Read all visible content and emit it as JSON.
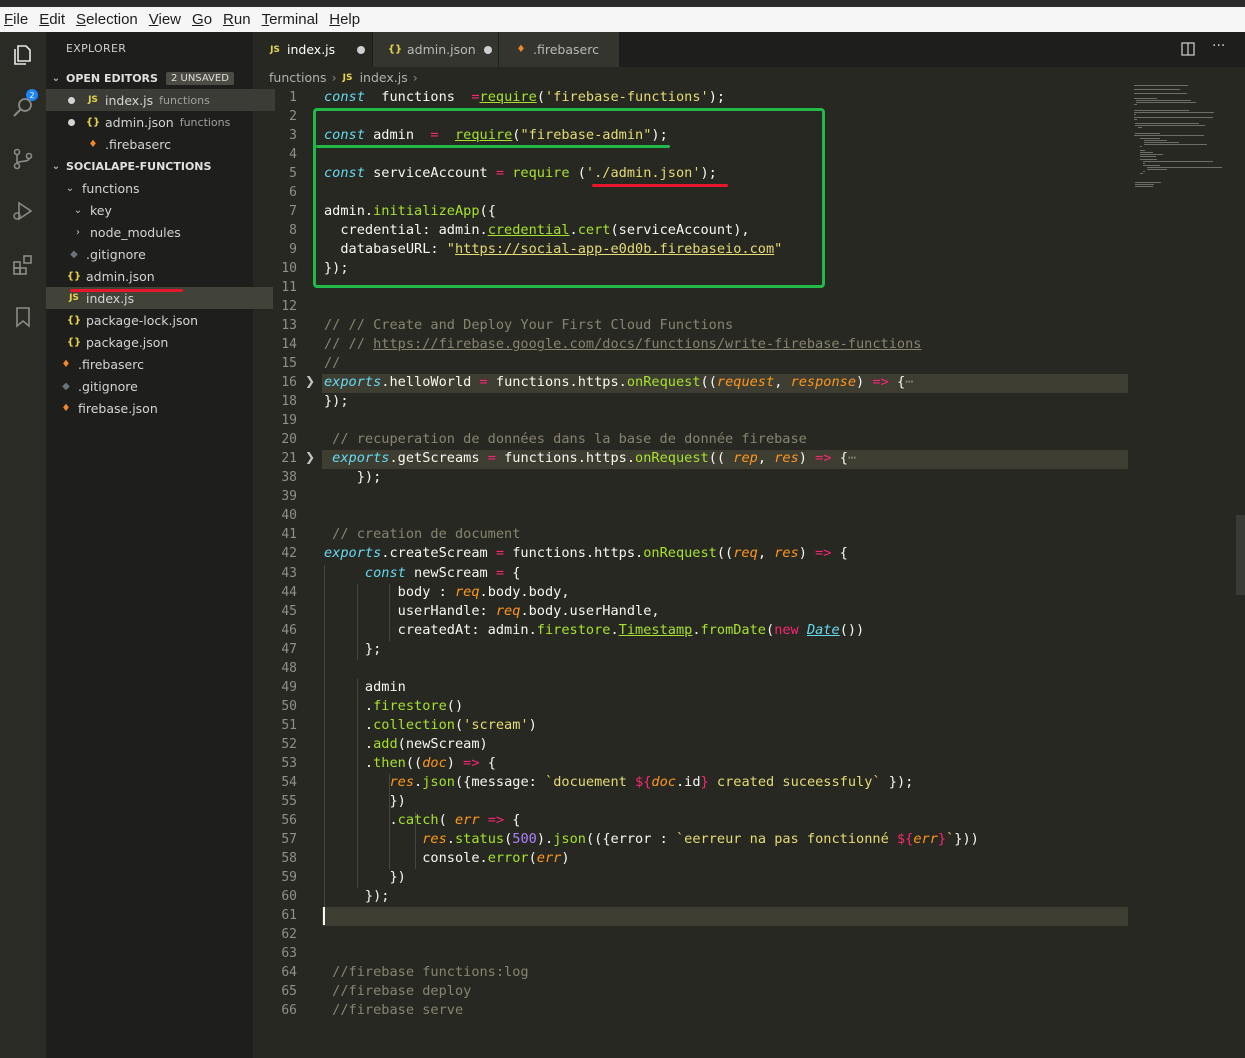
{
  "menu": [
    {
      "u": "F",
      "rest": "ile"
    },
    {
      "u": "E",
      "rest": "dit"
    },
    {
      "u": "S",
      "rest": "election"
    },
    {
      "u": "V",
      "rest": "iew"
    },
    {
      "u": "G",
      "rest": "o"
    },
    {
      "u": "R",
      "rest": "un"
    },
    {
      "u": "T",
      "rest": "erminal"
    },
    {
      "u": "H",
      "rest": "elp"
    }
  ],
  "activity": {
    "badge": "2"
  },
  "sidebar": {
    "title": "EXPLORER",
    "open_editors": {
      "label": "OPEN EDITORS",
      "unsaved": "2 UNSAVED",
      "items": [
        {
          "name": "index.js",
          "desc": "functions"
        },
        {
          "name": "admin.json",
          "desc": "functions"
        },
        {
          "name": ".firebaserc",
          "desc": ""
        }
      ]
    },
    "project": {
      "label": "SOCIALAPE-FUNCTIONS",
      "items": [
        {
          "name": "functions"
        },
        {
          "name": "key"
        },
        {
          "name": "node_modules"
        },
        {
          "name": ".gitignore"
        },
        {
          "name": "admin.json"
        },
        {
          "name": "index.js"
        },
        {
          "name": "package-lock.json"
        },
        {
          "name": "package.json"
        },
        {
          "name": ".firebaserc"
        },
        {
          "name": ".gitignore"
        },
        {
          "name": "firebase.json"
        }
      ]
    }
  },
  "tabs": [
    {
      "label": "index.js"
    },
    {
      "label": "admin.json"
    },
    {
      "label": ".firebaserc"
    }
  ],
  "breadcrumb": {
    "folder": "functions",
    "file": "index.js"
  },
  "editor": {
    "line_numbers": [
      "1",
      "2",
      "3",
      "4",
      "5",
      "6",
      "7",
      "8",
      "9",
      "10",
      "11",
      "12",
      "13",
      "14",
      "15",
      "16",
      "18",
      "19",
      "20",
      "21",
      "38",
      "39",
      "40",
      "41",
      "42",
      "43",
      "44",
      "45",
      "46",
      "47",
      "48",
      "49",
      "50",
      "51",
      "52",
      "53",
      "54",
      "55",
      "56",
      "57",
      "58",
      "59",
      "60",
      "61",
      "62",
      "63",
      "64",
      "65",
      "66"
    ],
    "lines": [
      [
        [
          "kw",
          "const"
        ],
        [
          "",
          "  functions  "
        ],
        [
          "op",
          "="
        ],
        [
          "",
          ""
        ],
        [
          "fn ul",
          "require"
        ],
        [
          "",
          "("
        ],
        [
          "str",
          "'firebase-functions'"
        ],
        [
          "",
          ");"
        ]
      ],
      [],
      [
        [
          "kw",
          "const"
        ],
        [
          "",
          " admin  "
        ],
        [
          "op",
          "="
        ],
        [
          "",
          "  "
        ],
        [
          "fn ul",
          "require"
        ],
        [
          "",
          "("
        ],
        [
          "str",
          "\"firebase-admin\""
        ],
        [
          "",
          ");"
        ]
      ],
      [],
      [
        [
          "kw",
          "const"
        ],
        [
          "",
          " serviceAccount "
        ],
        [
          "op",
          "="
        ],
        [
          "",
          " "
        ],
        [
          "fn",
          "require"
        ],
        [
          "",
          " ("
        ],
        [
          "str",
          "'./admin.json'"
        ],
        [
          "",
          ");"
        ]
      ],
      [],
      [
        [
          "",
          "admin."
        ],
        [
          "fn",
          "initializeApp"
        ],
        [
          "",
          "({"
        ]
      ],
      [
        [
          "",
          "  credential: admin."
        ],
        [
          "fn ul",
          "credential"
        ],
        [
          "",
          "."
        ],
        [
          "fn",
          "cert"
        ],
        [
          "",
          "(serviceAccount),"
        ]
      ],
      [
        [
          "",
          "  databaseURL: "
        ],
        [
          "str",
          "\""
        ],
        [
          "str ul",
          "https://social-app-e0d0b.firebaseio.com"
        ],
        [
          "str",
          "\""
        ]
      ],
      [
        [
          "",
          "});"
        ]
      ],
      [],
      [],
      [
        [
          "cm",
          "// // Create and Deploy Your First Cloud Functions"
        ]
      ],
      [
        [
          "cm",
          "// // "
        ],
        [
          "cm ul",
          "https://firebase.google.com/docs/functions/write-firebase-functions"
        ]
      ],
      [
        [
          "cm",
          "//"
        ]
      ],
      [
        [
          "ex",
          "exports"
        ],
        [
          "",
          ".helloWorld "
        ],
        [
          "op",
          "="
        ],
        [
          "",
          " functions.https."
        ],
        [
          "fn",
          "onRequest"
        ],
        [
          "",
          "(("
        ],
        [
          "par",
          "request"
        ],
        [
          "",
          ", "
        ],
        [
          "par",
          "response"
        ],
        [
          "",
          ") "
        ],
        [
          "op",
          "=>"
        ],
        [
          "",
          " {"
        ],
        [
          "cm",
          "⋯"
        ]
      ],
      [
        [
          "",
          ""
        ],
        [
          "",
          ""
        ],
        [
          "",
          "});"
        ]
      ],
      [],
      [
        [
          "cm",
          " // recuperation de données dans la base de donnée firebase"
        ]
      ],
      [
        [
          "ex",
          " exports"
        ],
        [
          "",
          ".getScreams "
        ],
        [
          "op",
          "="
        ],
        [
          "",
          " functions.https."
        ],
        [
          "fn",
          "onRequest"
        ],
        [
          "",
          "(( "
        ],
        [
          "par",
          "rep"
        ],
        [
          "",
          ", "
        ],
        [
          "par",
          "res"
        ],
        [
          "",
          ") "
        ],
        [
          "op",
          "=>"
        ],
        [
          "",
          " {"
        ],
        [
          "cm",
          "⋯"
        ]
      ],
      [
        [
          "",
          "    });"
        ]
      ],
      [],
      [],
      [
        [
          "cm",
          " // creation de document"
        ]
      ],
      [
        [
          "ex",
          "exports"
        ],
        [
          "",
          ".createScream "
        ],
        [
          "op",
          "="
        ],
        [
          "",
          " functions.https."
        ],
        [
          "fn",
          "onRequest"
        ],
        [
          "",
          "(("
        ],
        [
          "par",
          "req"
        ],
        [
          "",
          ", "
        ],
        [
          "par",
          "res"
        ],
        [
          "",
          ") "
        ],
        [
          "op",
          "=>"
        ],
        [
          "",
          " {"
        ]
      ],
      [
        [
          "",
          "     "
        ],
        [
          "kw",
          "const"
        ],
        [
          "",
          " newScream "
        ],
        [
          "op",
          "="
        ],
        [
          "",
          " {"
        ]
      ],
      [
        [
          "",
          "         body : "
        ],
        [
          "par",
          "req"
        ],
        [
          "",
          ".body.body,"
        ]
      ],
      [
        [
          "",
          "         userHandle: "
        ],
        [
          "par",
          "req"
        ],
        [
          "",
          ".body.userHandle,"
        ]
      ],
      [
        [
          "",
          "         createdAt: admin."
        ],
        [
          "fn",
          "firestore"
        ],
        [
          "",
          "."
        ],
        [
          "fn ul",
          "Timestamp"
        ],
        [
          "",
          "."
        ],
        [
          "fn",
          "fromDate"
        ],
        [
          "",
          "("
        ],
        [
          "op",
          "new"
        ],
        [
          "",
          " "
        ],
        [
          "kw ul",
          "Date"
        ],
        [
          "",
          "())"
        ]
      ],
      [
        [
          "",
          "     };"
        ]
      ],
      [],
      [
        [
          "",
          "     admin"
        ]
      ],
      [
        [
          "",
          "     ."
        ],
        [
          "fn",
          "firestore"
        ],
        [
          "",
          "()"
        ]
      ],
      [
        [
          "",
          "     ."
        ],
        [
          "fn",
          "collection"
        ],
        [
          "",
          "("
        ],
        [
          "str",
          "'scream'"
        ],
        [
          "",
          ")"
        ]
      ],
      [
        [
          "",
          "     ."
        ],
        [
          "fn",
          "add"
        ],
        [
          "",
          "(newScream)"
        ]
      ],
      [
        [
          "",
          "     ."
        ],
        [
          "fn",
          "then"
        ],
        [
          "",
          "(("
        ],
        [
          "par",
          "doc"
        ],
        [
          "",
          ") "
        ],
        [
          "op",
          "=>"
        ],
        [
          "",
          " {"
        ]
      ],
      [
        [
          "",
          "        "
        ],
        [
          "par",
          "res"
        ],
        [
          "",
          "."
        ],
        [
          "fn",
          "json"
        ],
        [
          "",
          "({message: "
        ],
        [
          "str",
          "`docuement "
        ],
        [
          "op",
          "${"
        ],
        [
          "par",
          "doc"
        ],
        [
          "",
          ".id"
        ],
        [
          "op",
          "}"
        ],
        [
          "str",
          " created suceessfuly`"
        ],
        [
          "",
          " });"
        ]
      ],
      [
        [
          "",
          "        })"
        ]
      ],
      [
        [
          "",
          "        ."
        ],
        [
          "fn",
          "catch"
        ],
        [
          "",
          "( "
        ],
        [
          "par",
          "err"
        ],
        [
          "",
          " "
        ],
        [
          "op",
          "=>"
        ],
        [
          "",
          " {"
        ]
      ],
      [
        [
          "",
          "            "
        ],
        [
          "par",
          "res"
        ],
        [
          "",
          "."
        ],
        [
          "fn",
          "status"
        ],
        [
          "",
          "("
        ],
        [
          "num",
          "500"
        ],
        [
          "",
          ")."
        ],
        [
          "fn",
          "json"
        ],
        [
          "",
          "(({error : "
        ],
        [
          "str",
          "`eerreur na pas fonctionné "
        ],
        [
          "op",
          "${"
        ],
        [
          "par",
          "err"
        ],
        [
          "op",
          "}"
        ],
        [
          "str",
          "`"
        ],
        [
          "",
          "}))"
        ]
      ],
      [
        [
          "",
          "            console."
        ],
        [
          "fn",
          "error"
        ],
        [
          "",
          "("
        ],
        [
          "par",
          "err"
        ],
        [
          "",
          ")"
        ]
      ],
      [
        [
          "",
          "        })"
        ]
      ],
      [
        [
          "",
          "     });"
        ]
      ],
      [],
      [],
      [],
      [
        [
          "cm",
          " //firebase functions:log"
        ]
      ],
      [
        [
          "cm",
          " //firebase deploy"
        ]
      ],
      [
        [
          "cm",
          " //firebase serve"
        ]
      ]
    ]
  }
}
